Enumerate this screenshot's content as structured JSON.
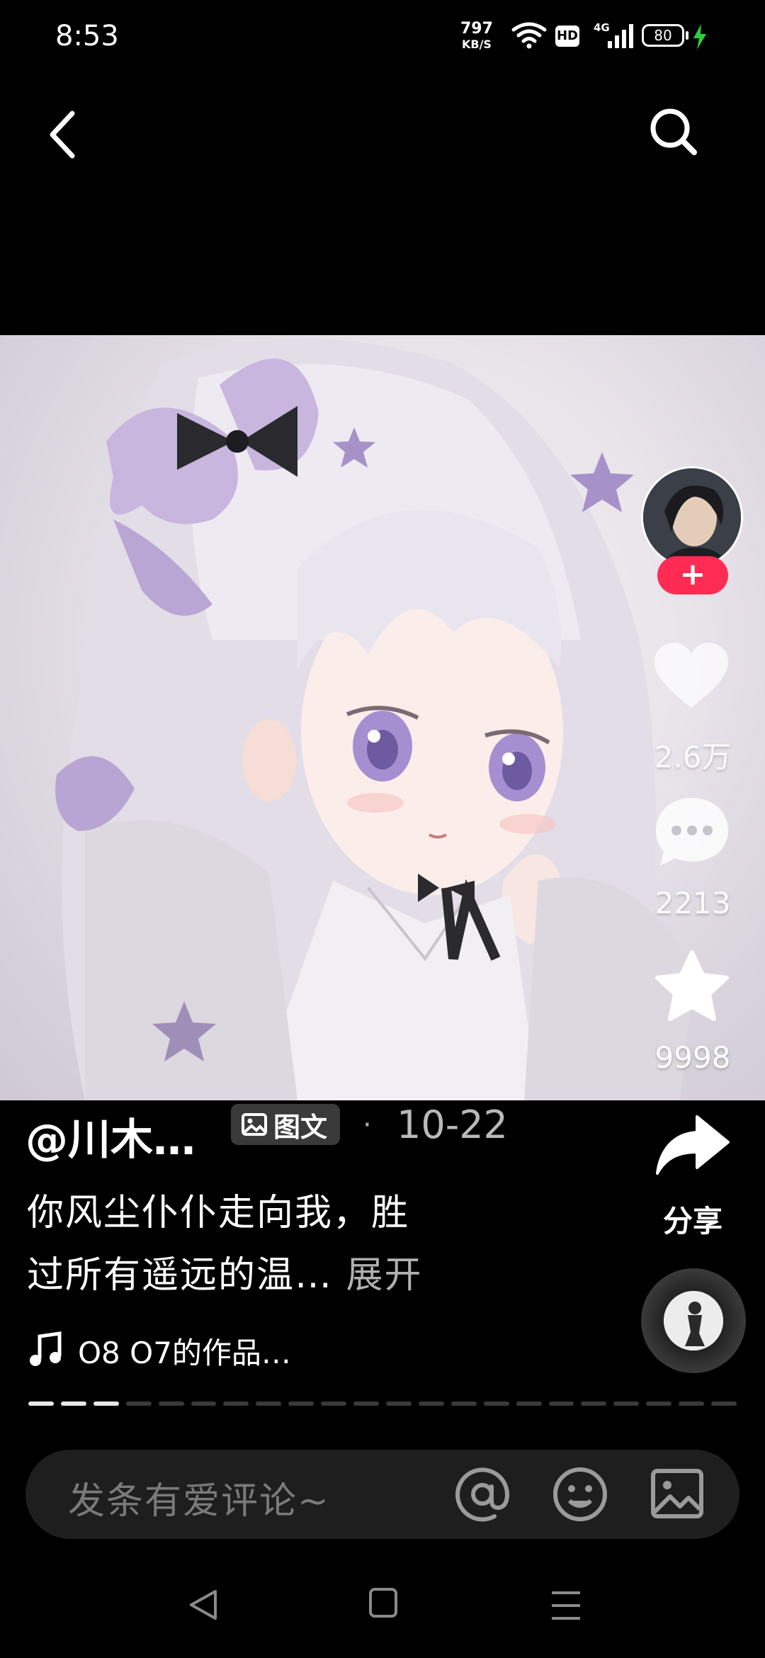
{
  "status_bar": {
    "time": "8:53",
    "net_speed": "797",
    "net_unit": "KB/S",
    "hd": "HD",
    "network": "4G",
    "battery": "80"
  },
  "nav": {
    "back_icon": "chevron-left-icon",
    "search_icon": "search-icon"
  },
  "actions": {
    "follow": "+",
    "like_count": "2.6万",
    "comment_count": "2213",
    "favorite_count": "9998",
    "share_label": "分享"
  },
  "post": {
    "author": "@川木…",
    "type_badge": "图文",
    "date_separator": "·",
    "date": "10-22",
    "caption_line1": "你风尘仆仆走向我，胜",
    "caption_line2": "过所有遥远的温…",
    "expand": "展开",
    "music": "O8 O7的作品…",
    "progress_total": 22,
    "progress_active": 3
  },
  "comment_bar": {
    "placeholder": "发条有爱评论~"
  },
  "colors": {
    "accent": "#fe2c55",
    "background": "#000000"
  }
}
